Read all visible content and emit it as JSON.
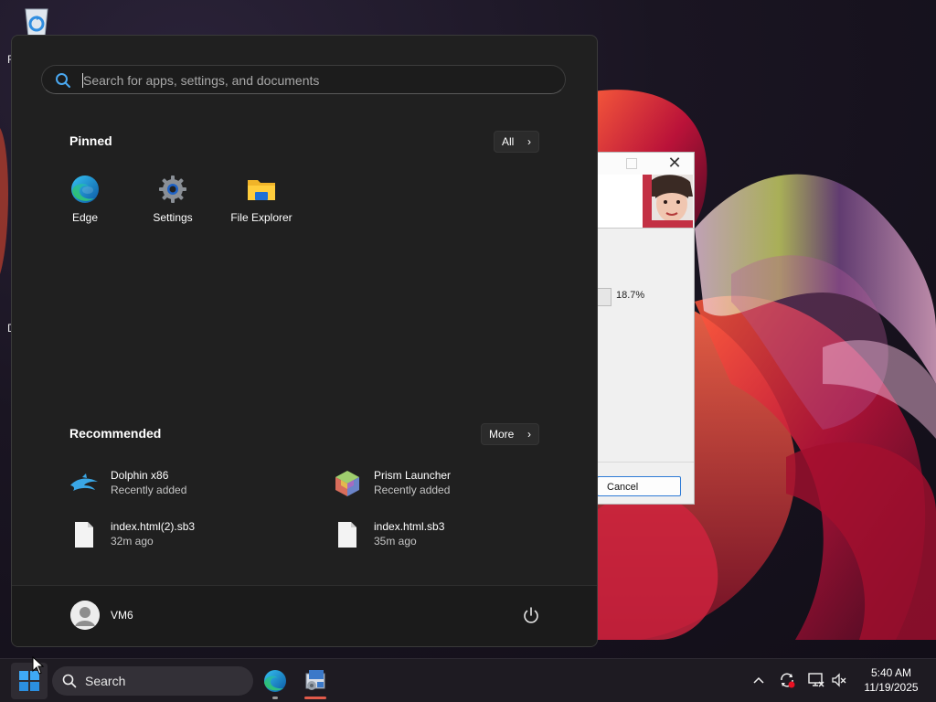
{
  "desktop": {
    "labels": [
      "R",
      "D"
    ]
  },
  "dialog": {
    "percent": "18.7%",
    "cancel_label": "Cancel"
  },
  "start_menu": {
    "search_placeholder": "Search for apps, settings, and documents",
    "pinned": {
      "title": "Pinned",
      "all_label": "All",
      "apps": [
        {
          "label": "Edge",
          "icon": "edge-icon"
        },
        {
          "label": "Settings",
          "icon": "gear-icon"
        },
        {
          "label": "File Explorer",
          "icon": "folder-icon"
        }
      ]
    },
    "recommended": {
      "title": "Recommended",
      "more_label": "More",
      "items": [
        {
          "name": "Dolphin x86",
          "sub": "Recently added",
          "icon": "dolphin-icon"
        },
        {
          "name": "Prism Launcher",
          "sub": "Recently added",
          "icon": "prism-icon"
        },
        {
          "name": "index.html(2).sb3",
          "sub": "32m ago",
          "icon": "file-icon"
        },
        {
          "name": "index.html.sb3",
          "sub": "35m ago",
          "icon": "file-icon"
        }
      ]
    },
    "user": {
      "name": "VM6"
    }
  },
  "taskbar": {
    "search_label": "Search",
    "clock": {
      "time": "5:40 AM",
      "date": "11/19/2025"
    }
  },
  "colors": {
    "accent": "#0078d4",
    "menu_bg": "#202020",
    "taskbar_bg": "#1e1b22"
  }
}
